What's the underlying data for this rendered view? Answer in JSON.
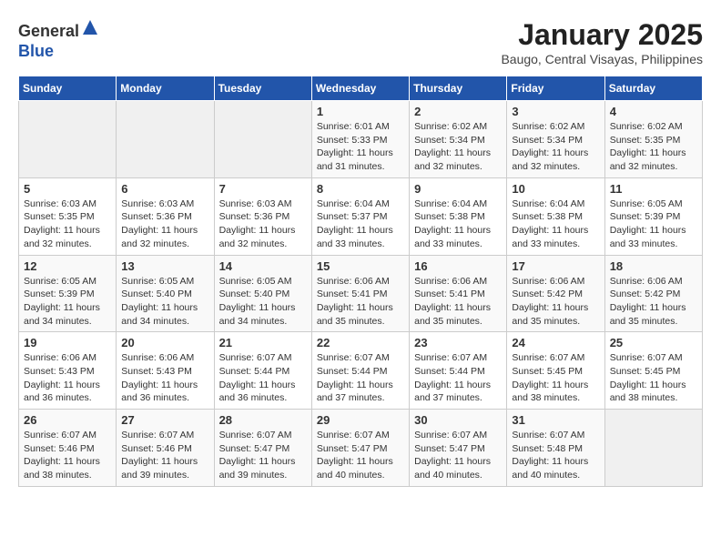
{
  "header": {
    "logo_line1": "General",
    "logo_line2": "Blue",
    "title": "January 2025",
    "subtitle": "Baugo, Central Visayas, Philippines"
  },
  "weekdays": [
    "Sunday",
    "Monday",
    "Tuesday",
    "Wednesday",
    "Thursday",
    "Friday",
    "Saturday"
  ],
  "weeks": [
    [
      {
        "day": "",
        "info": ""
      },
      {
        "day": "",
        "info": ""
      },
      {
        "day": "",
        "info": ""
      },
      {
        "day": "1",
        "info": "Sunrise: 6:01 AM\nSunset: 5:33 PM\nDaylight: 11 hours\nand 31 minutes."
      },
      {
        "day": "2",
        "info": "Sunrise: 6:02 AM\nSunset: 5:34 PM\nDaylight: 11 hours\nand 32 minutes."
      },
      {
        "day": "3",
        "info": "Sunrise: 6:02 AM\nSunset: 5:34 PM\nDaylight: 11 hours\nand 32 minutes."
      },
      {
        "day": "4",
        "info": "Sunrise: 6:02 AM\nSunset: 5:35 PM\nDaylight: 11 hours\nand 32 minutes."
      }
    ],
    [
      {
        "day": "5",
        "info": "Sunrise: 6:03 AM\nSunset: 5:35 PM\nDaylight: 11 hours\nand 32 minutes."
      },
      {
        "day": "6",
        "info": "Sunrise: 6:03 AM\nSunset: 5:36 PM\nDaylight: 11 hours\nand 32 minutes."
      },
      {
        "day": "7",
        "info": "Sunrise: 6:03 AM\nSunset: 5:36 PM\nDaylight: 11 hours\nand 32 minutes."
      },
      {
        "day": "8",
        "info": "Sunrise: 6:04 AM\nSunset: 5:37 PM\nDaylight: 11 hours\nand 33 minutes."
      },
      {
        "day": "9",
        "info": "Sunrise: 6:04 AM\nSunset: 5:38 PM\nDaylight: 11 hours\nand 33 minutes."
      },
      {
        "day": "10",
        "info": "Sunrise: 6:04 AM\nSunset: 5:38 PM\nDaylight: 11 hours\nand 33 minutes."
      },
      {
        "day": "11",
        "info": "Sunrise: 6:05 AM\nSunset: 5:39 PM\nDaylight: 11 hours\nand 33 minutes."
      }
    ],
    [
      {
        "day": "12",
        "info": "Sunrise: 6:05 AM\nSunset: 5:39 PM\nDaylight: 11 hours\nand 34 minutes."
      },
      {
        "day": "13",
        "info": "Sunrise: 6:05 AM\nSunset: 5:40 PM\nDaylight: 11 hours\nand 34 minutes."
      },
      {
        "day": "14",
        "info": "Sunrise: 6:05 AM\nSunset: 5:40 PM\nDaylight: 11 hours\nand 34 minutes."
      },
      {
        "day": "15",
        "info": "Sunrise: 6:06 AM\nSunset: 5:41 PM\nDaylight: 11 hours\nand 35 minutes."
      },
      {
        "day": "16",
        "info": "Sunrise: 6:06 AM\nSunset: 5:41 PM\nDaylight: 11 hours\nand 35 minutes."
      },
      {
        "day": "17",
        "info": "Sunrise: 6:06 AM\nSunset: 5:42 PM\nDaylight: 11 hours\nand 35 minutes."
      },
      {
        "day": "18",
        "info": "Sunrise: 6:06 AM\nSunset: 5:42 PM\nDaylight: 11 hours\nand 35 minutes."
      }
    ],
    [
      {
        "day": "19",
        "info": "Sunrise: 6:06 AM\nSunset: 5:43 PM\nDaylight: 11 hours\nand 36 minutes."
      },
      {
        "day": "20",
        "info": "Sunrise: 6:06 AM\nSunset: 5:43 PM\nDaylight: 11 hours\nand 36 minutes."
      },
      {
        "day": "21",
        "info": "Sunrise: 6:07 AM\nSunset: 5:44 PM\nDaylight: 11 hours\nand 36 minutes."
      },
      {
        "day": "22",
        "info": "Sunrise: 6:07 AM\nSunset: 5:44 PM\nDaylight: 11 hours\nand 37 minutes."
      },
      {
        "day": "23",
        "info": "Sunrise: 6:07 AM\nSunset: 5:44 PM\nDaylight: 11 hours\nand 37 minutes."
      },
      {
        "day": "24",
        "info": "Sunrise: 6:07 AM\nSunset: 5:45 PM\nDaylight: 11 hours\nand 38 minutes."
      },
      {
        "day": "25",
        "info": "Sunrise: 6:07 AM\nSunset: 5:45 PM\nDaylight: 11 hours\nand 38 minutes."
      }
    ],
    [
      {
        "day": "26",
        "info": "Sunrise: 6:07 AM\nSunset: 5:46 PM\nDaylight: 11 hours\nand 38 minutes."
      },
      {
        "day": "27",
        "info": "Sunrise: 6:07 AM\nSunset: 5:46 PM\nDaylight: 11 hours\nand 39 minutes."
      },
      {
        "day": "28",
        "info": "Sunrise: 6:07 AM\nSunset: 5:47 PM\nDaylight: 11 hours\nand 39 minutes."
      },
      {
        "day": "29",
        "info": "Sunrise: 6:07 AM\nSunset: 5:47 PM\nDaylight: 11 hours\nand 40 minutes."
      },
      {
        "day": "30",
        "info": "Sunrise: 6:07 AM\nSunset: 5:47 PM\nDaylight: 11 hours\nand 40 minutes."
      },
      {
        "day": "31",
        "info": "Sunrise: 6:07 AM\nSunset: 5:48 PM\nDaylight: 11 hours\nand 40 minutes."
      },
      {
        "day": "",
        "info": ""
      }
    ]
  ]
}
